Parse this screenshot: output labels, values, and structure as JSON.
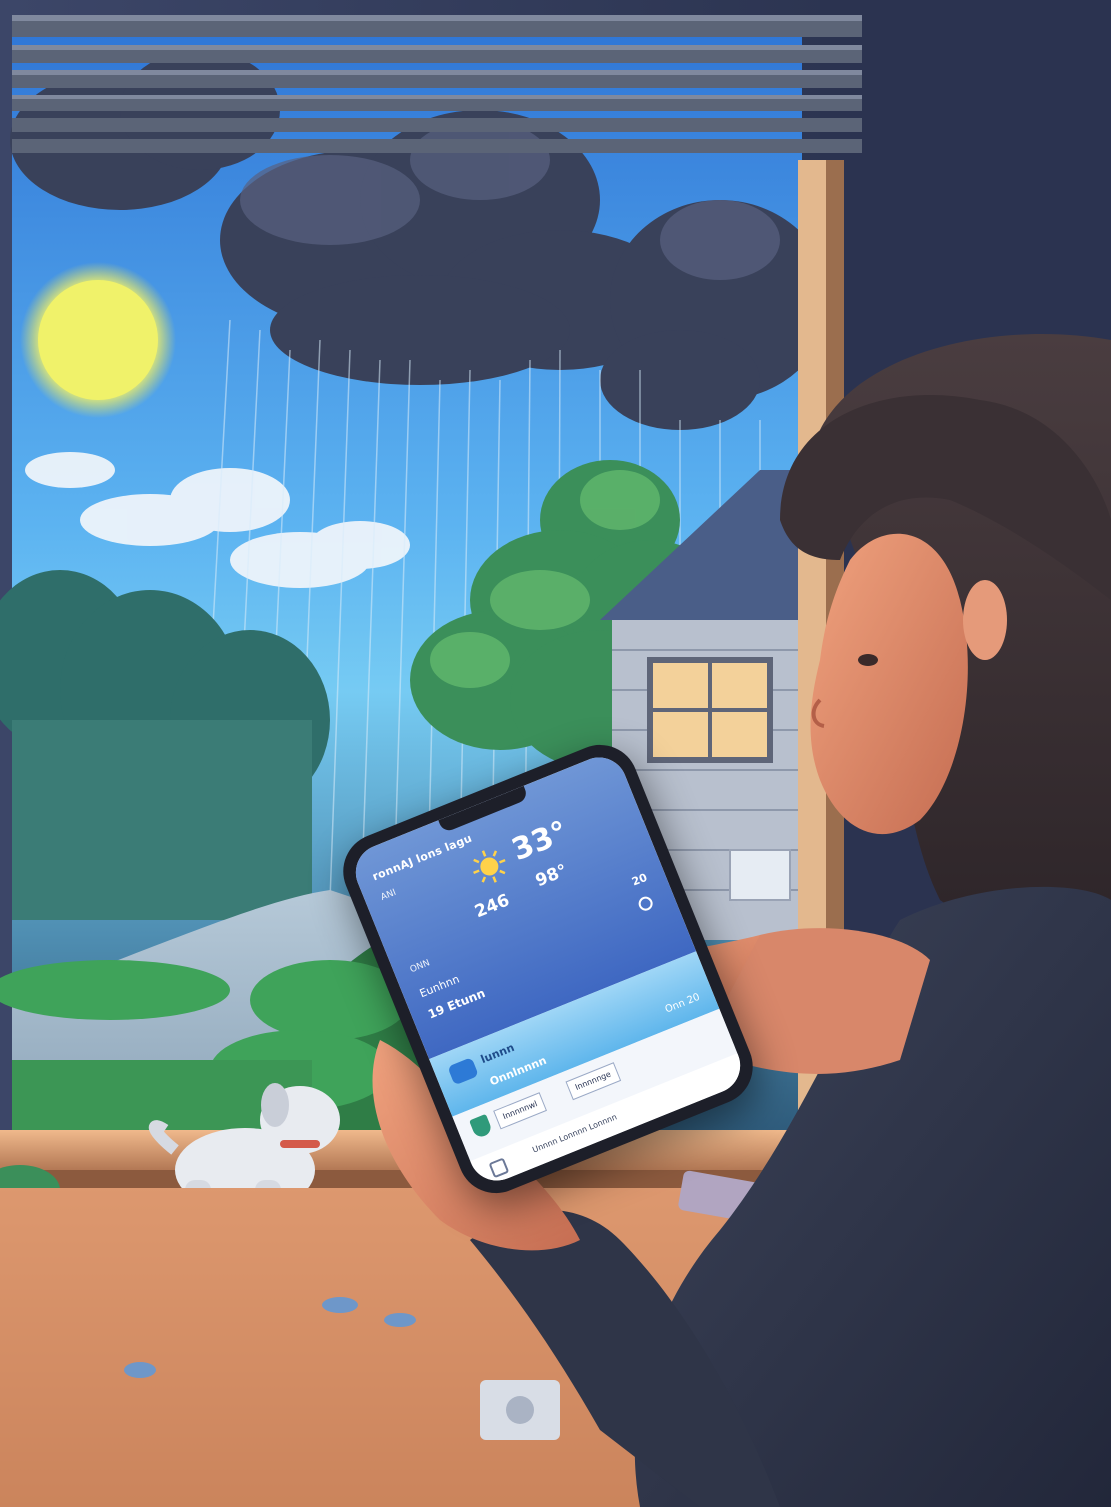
{
  "phone_app": {
    "header_title": "ronnAJ lons lagu",
    "menu_chip": "ANI",
    "temperature": "33°",
    "low_temp": "246",
    "feels_like": "98°",
    "wind_label": "ONN",
    "right_stat": "20",
    "row1_text": "Eunhnn",
    "row2_text": "19 Etunn",
    "band_label": "lunnn",
    "band_button": "Onnlnnnn",
    "band_time": "Onn 20",
    "chip1": "Innnnnwl",
    "chip2": "Innnnnge",
    "nav_text": "Unnnn Lonnnn Lonnnn"
  },
  "colors": {
    "sky_top": "#3b8fe3",
    "sun": "#f2f36a",
    "phone_card": "#3f68c2",
    "accent_band": "#5fb6ec"
  }
}
